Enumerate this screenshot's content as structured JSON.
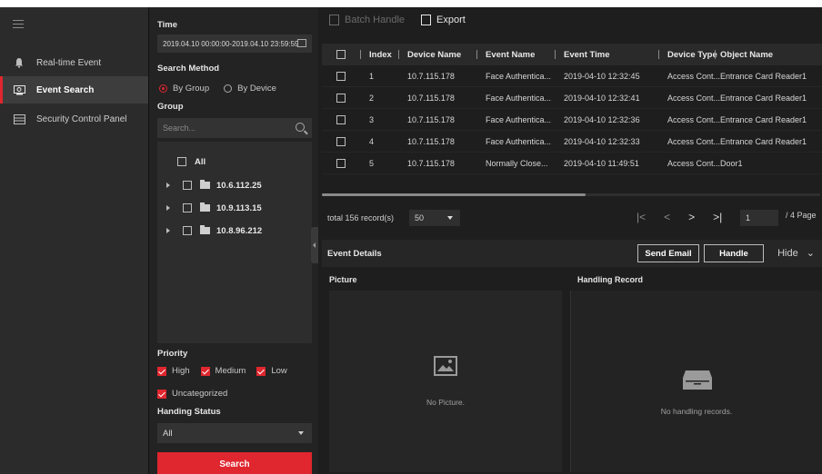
{
  "nav": {
    "items": [
      {
        "label": "Real-time Event",
        "icon": "bell-icon",
        "active": false
      },
      {
        "label": "Event Search",
        "icon": "monitor-search-icon",
        "active": true
      },
      {
        "label": "Security Control Panel",
        "icon": "panel-icon",
        "active": false
      }
    ]
  },
  "filter": {
    "time_label": "Time",
    "time_value": "2019.04.10 00:00:00-2019.04.10 23:59:59",
    "search_method_label": "Search Method",
    "by_group": "By Group",
    "by_device": "By Device",
    "group_label": "Group",
    "search_placeholder": "Search...",
    "tree": {
      "all": "All",
      "nodes": [
        "10.6.112.25",
        "10.9.113.15",
        "10.8.96.212"
      ]
    },
    "priority_label": "Priority",
    "priority": {
      "high": "High",
      "medium": "Medium",
      "low": "Low",
      "uncategorized": "Uncategorized"
    },
    "handling_status_label": "Handing Status",
    "handling_status_value": "All",
    "search_button": "Search"
  },
  "toolbar": {
    "batch_handle": "Batch Handle",
    "export": "Export"
  },
  "table": {
    "headers": {
      "index": "Index",
      "device_name": "Device Name",
      "event_name": "Event Name",
      "event_time": "Event Time",
      "device_type": "Device Type",
      "object_name": "Object Name"
    },
    "rows": [
      {
        "index": "1",
        "device": "10.7.115.178",
        "event": "Face Authentica...",
        "time": "2019-04-10 12:32:45",
        "type": "Access Cont...",
        "object": "Entrance Card Reader1"
      },
      {
        "index": "2",
        "device": "10.7.115.178",
        "event": "Face Authentica...",
        "time": "2019-04-10 12:32:41",
        "type": "Access Cont...",
        "object": "Entrance Card Reader1"
      },
      {
        "index": "3",
        "device": "10.7.115.178",
        "event": "Face Authentica...",
        "time": "2019-04-10 12:32:36",
        "type": "Access Cont...",
        "object": "Entrance Card Reader1"
      },
      {
        "index": "4",
        "device": "10.7.115.178",
        "event": "Face Authentica...",
        "time": "2019-04-10 12:32:33",
        "type": "Access Cont...",
        "object": "Entrance Card Reader1"
      },
      {
        "index": "5",
        "device": "10.7.115.178",
        "event": "Normally Close...",
        "time": "2019-04-10 11:49:51",
        "type": "Access Cont...",
        "object": "Door1"
      }
    ]
  },
  "pager": {
    "total": "total 156 record(s)",
    "page_size": "50",
    "current_page": "1",
    "total_pages": "/ 4 Page"
  },
  "details": {
    "title": "Event Details",
    "send_email": "Send Email",
    "handle": "Handle",
    "hide": "Hide",
    "picture_label": "Picture",
    "handling_record_label": "Handling Record",
    "no_picture": "No Picture.",
    "no_handling": "No handling records."
  },
  "colors": {
    "accent": "#e0262e",
    "bg": "#1e1e1e",
    "nav_bg": "#2b2b2b"
  }
}
